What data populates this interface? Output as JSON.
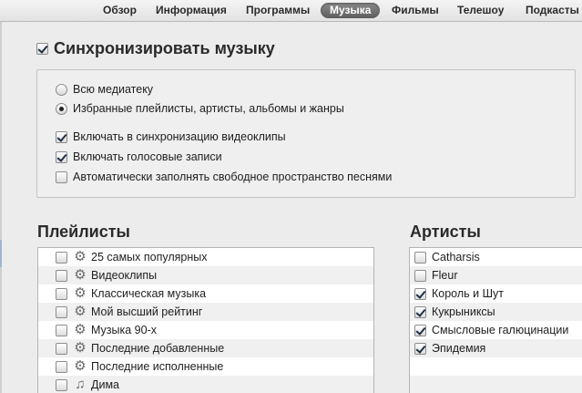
{
  "tabs": [
    {
      "label": "Обзор",
      "active": false
    },
    {
      "label": "Информация",
      "active": false
    },
    {
      "label": "Программы",
      "active": false
    },
    {
      "label": "Музыка",
      "active": true
    },
    {
      "label": "Фильмы",
      "active": false
    },
    {
      "label": "Телешоу",
      "active": false
    },
    {
      "label": "Подкасты",
      "active": false
    }
  ],
  "sync": {
    "label": "Синхронизировать музыку",
    "checked": true
  },
  "options": {
    "radio_all": {
      "label": "Всю медиатеку",
      "selected": false
    },
    "radio_selected": {
      "label": "Избранные плейлисты, артисты, альбомы и жанры",
      "selected": true
    },
    "include_videos": {
      "label": "Включать в синхронизацию видеоклипы",
      "checked": true
    },
    "include_voice": {
      "label": "Включать голосовые записи",
      "checked": true
    },
    "autofill": {
      "label": "Автоматически заполнять свободное пространство песнями",
      "checked": false
    }
  },
  "playlists": {
    "title": "Плейлисты",
    "items": [
      {
        "label": "25 самых популярных",
        "icon": "gear-icon",
        "checked": false
      },
      {
        "label": "Видеоклипы",
        "icon": "gear-icon",
        "checked": false
      },
      {
        "label": "Классическая музыка",
        "icon": "gear-icon",
        "checked": false
      },
      {
        "label": "Мой высший рейтинг",
        "icon": "gear-icon",
        "checked": false
      },
      {
        "label": "Музыка 90-х",
        "icon": "gear-icon",
        "checked": false
      },
      {
        "label": "Последние добавленные",
        "icon": "gear-icon",
        "checked": false
      },
      {
        "label": "Последние исполненные",
        "icon": "gear-icon",
        "checked": false
      },
      {
        "label": "Дима",
        "icon": "playlist-icon",
        "checked": false
      }
    ]
  },
  "artists": {
    "title": "Артисты",
    "items": [
      {
        "label": "Catharsis",
        "checked": false
      },
      {
        "label": "Fleur",
        "checked": false
      },
      {
        "label": "Король и Шут",
        "checked": true
      },
      {
        "label": "Кукрыниксы",
        "checked": true
      },
      {
        "label": "Смысловые галюцинации",
        "checked": true
      },
      {
        "label": "Эпидемия",
        "checked": true
      }
    ]
  }
}
